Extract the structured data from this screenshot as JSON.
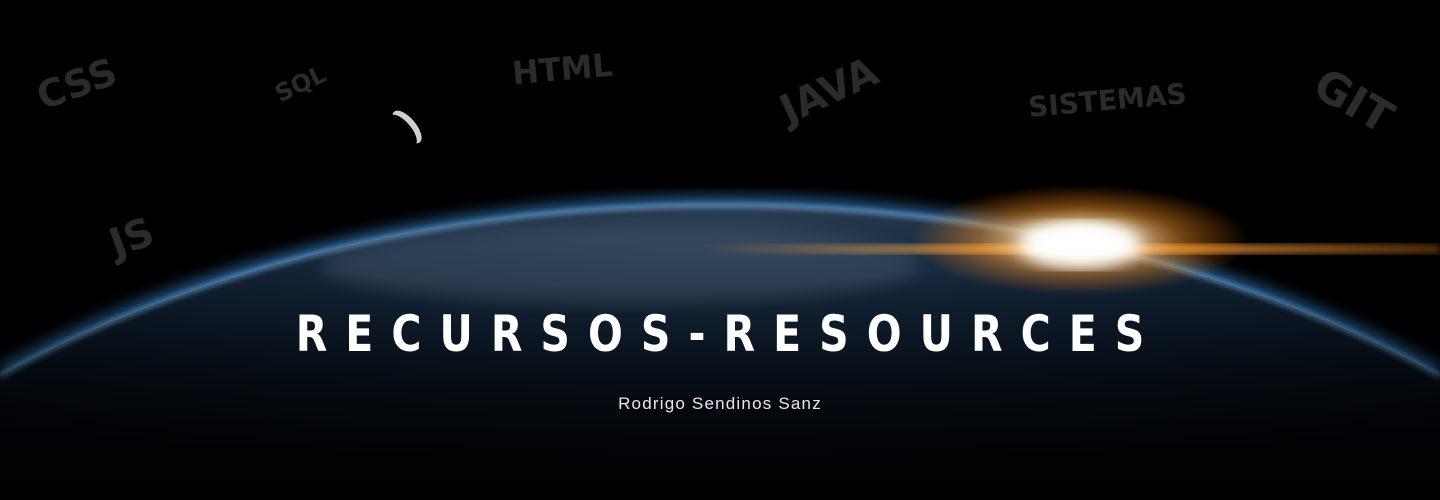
{
  "banner": {
    "title": "RECURSOS-RESOURCES",
    "subtitle": "Rodrigo Sendinos Sanz",
    "tags": [
      "CSS",
      "SQL",
      "HTML",
      "JAVA",
      "SISTEMAS",
      "GIT",
      "JS"
    ]
  },
  "colors": {
    "background": "#000000",
    "tag": "#2b2b2b",
    "glow": "#4aa8ff",
    "sun": "#ffb347"
  }
}
